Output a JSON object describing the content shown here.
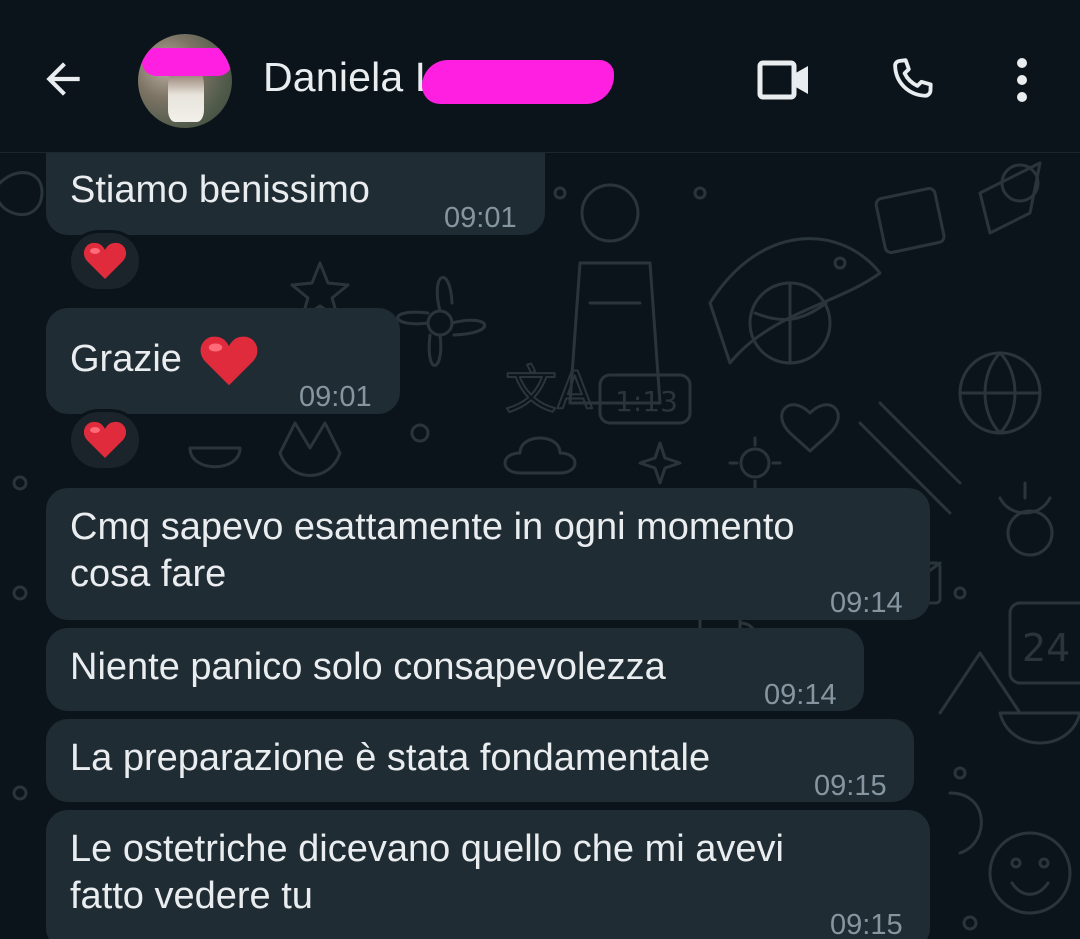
{
  "header": {
    "contact_name": "Daniela Li",
    "back_icon": "arrow-left-icon",
    "video_icon": "video-camera-icon",
    "call_icon": "phone-icon",
    "menu_icon": "more-vertical-icon",
    "redaction_color": "#ff1fe0"
  },
  "messages": [
    {
      "text": "Stiamo benissimo",
      "time": "09:01",
      "reaction": "❤️"
    },
    {
      "text": "Grazie",
      "emoji": "❤️",
      "time": "09:01",
      "reaction": "❤️"
    },
    {
      "line1": "Cmq sapevo esattamente in ogni momento",
      "line2": "cosa fare",
      "time": "09:14"
    },
    {
      "text": "Niente panico solo consapevolezza",
      "time": "09:14"
    },
    {
      "text": "La preparazione è stata fondamentale",
      "time": "09:15"
    },
    {
      "line1": "Le ostetriche dicevano quello che mi avevi",
      "line2": "fatto vedere tu",
      "time": "09:15"
    }
  ],
  "wallpaper": {
    "clock_text": "1:13",
    "calendar_text": "24",
    "letters": "文A"
  },
  "colors": {
    "background": "#0b141a",
    "bubble": "#202c33",
    "text": "#e9edef",
    "timestamp": "#8696a0",
    "heart": "#e02b3c"
  }
}
